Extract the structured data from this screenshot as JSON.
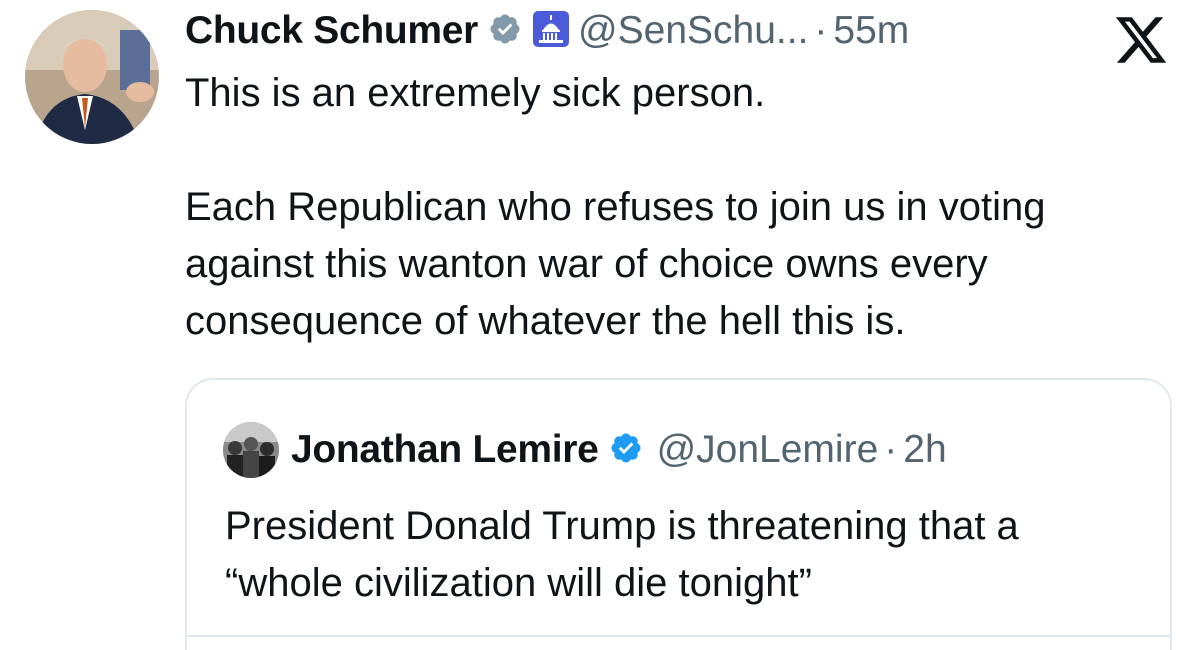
{
  "author": {
    "name": "Chuck Schumer",
    "handle": "@SenSchu...",
    "separator": "·",
    "time": "55m",
    "verified_icon": "verified-badge-icon",
    "affiliation_icon": "capitol-dome-icon"
  },
  "platform": {
    "logo": "x-logo-icon"
  },
  "tweet": {
    "line1": "This is an extremely sick person.",
    "line2": "Each Republican who refuses to join us in voting against this wanton war of choice owns every consequence of whatever the hell this is."
  },
  "quoted": {
    "name": "Jonathan Lemire",
    "handle": "@JonLemire",
    "separator": "·",
    "time": "2h",
    "verified_icon": "verified-badge-icon",
    "text": "President Donald Trump is threatening that a “whole civilization will die tonight”"
  },
  "colors": {
    "text": "#0f1419",
    "secondary": "#536471",
    "verified": "#1d9bf0",
    "affiliation": "#4a5ad8",
    "border": "#e1e8ed"
  }
}
